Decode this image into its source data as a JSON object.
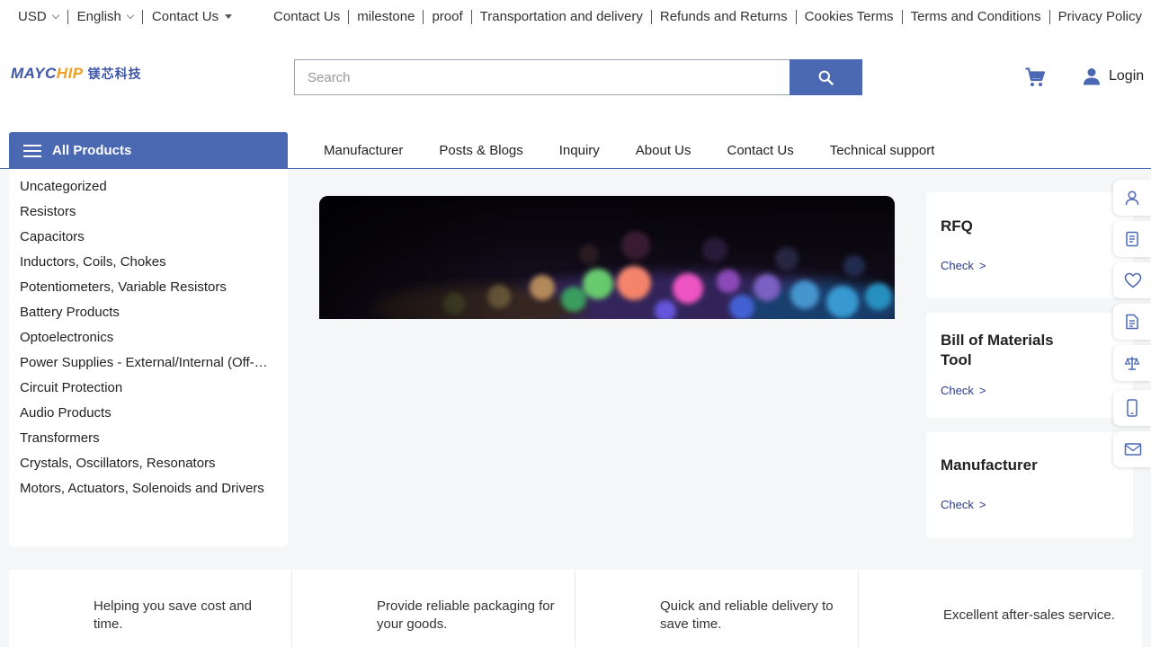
{
  "topbar": {
    "currency": "USD",
    "language": "English",
    "contact": "Contact Us",
    "links": [
      "Contact Us",
      "milestone",
      "proof",
      "Transportation and delivery",
      "Refunds and Returns",
      "Cookies Terms",
      "Terms and Conditions",
      "Privacy Policy"
    ]
  },
  "header": {
    "logo_mark_a": "MAYC",
    "logo_mark_b": "HIP",
    "logo_cn": "镁芯科技",
    "search_placeholder": "Search",
    "login_label": "Login"
  },
  "nav": {
    "all_products": "All Products",
    "links": [
      "Manufacturer",
      "Posts & Blogs",
      "Inquiry",
      "About Us",
      "Contact Us",
      "Technical support"
    ]
  },
  "categories": [
    "Uncategorized",
    "Resistors",
    "Capacitors",
    "Inductors, Coils, Chokes",
    "Potentiometers, Variable Resistors",
    "Battery Products",
    "Optoelectronics",
    "Power Supplies - External/Internal (Off-Board)",
    "Circuit Protection",
    "Audio Products",
    "Transformers",
    "Crystals, Oscillators, Resonators",
    "Motors, Actuators, Solenoids and Drivers"
  ],
  "cards": [
    {
      "title": "RFQ",
      "check": "Check",
      "arrow": ">"
    },
    {
      "title": "Bill of Materials Tool",
      "check": "Check",
      "arrow": ">"
    },
    {
      "title": "Manufacturer",
      "check": "Check",
      "arrow": ">"
    }
  ],
  "side_tools": [
    "user-icon",
    "document-icon",
    "heart-icon",
    "file-icon",
    "scale-icon",
    "phone-icon",
    "mail-icon"
  ],
  "features": [
    "Helping you save cost and time.",
    "Provide reliable packaging for your goods.",
    "Quick and reliable delivery to save time.",
    "Excellent after-sales service."
  ],
  "colors": {
    "accent": "#4b68b3",
    "link": "#2a3b8f",
    "page_bg": "#f5f6f8"
  }
}
